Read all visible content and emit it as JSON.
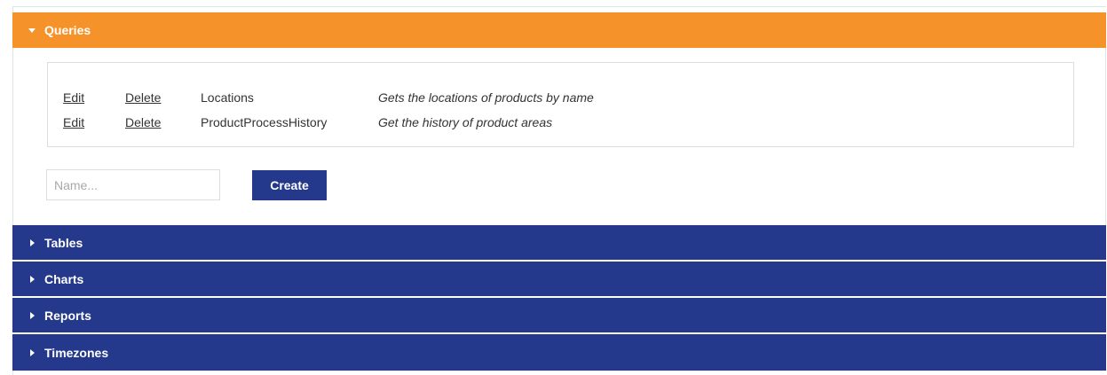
{
  "panels": {
    "queries": {
      "label": "Queries",
      "expanded": true
    },
    "tables": {
      "label": "Tables",
      "expanded": false
    },
    "charts": {
      "label": "Charts",
      "expanded": false
    },
    "reports": {
      "label": "Reports",
      "expanded": false
    },
    "timezones": {
      "label": "Timezones",
      "expanded": false
    }
  },
  "queries": {
    "items": [
      {
        "edit_label": "Edit",
        "delete_label": "Delete",
        "name": "Locations",
        "description": "Gets the locations of products by name"
      },
      {
        "edit_label": "Edit",
        "delete_label": "Delete",
        "name": "ProductProcessHistory",
        "description": "Get the history of product areas"
      }
    ],
    "name_input": {
      "value": "",
      "placeholder": "Name..."
    },
    "create_label": "Create"
  },
  "colors": {
    "expanded_header": "#f5932a",
    "collapsed_header": "#25398c",
    "button": "#25398c"
  },
  "icons": {
    "expanded": "caret-down-icon",
    "collapsed": "caret-right-icon"
  }
}
